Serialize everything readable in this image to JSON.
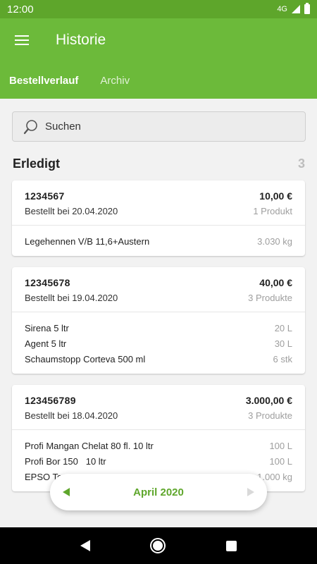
{
  "status_bar": {
    "time": "12:00",
    "network": "4G"
  },
  "app_bar": {
    "title": "Historie",
    "menu_icon": "hamburger-menu-icon"
  },
  "tabs": [
    {
      "label": "Bestellverlauf",
      "active": true
    },
    {
      "label": "Archiv",
      "active": false
    }
  ],
  "search": {
    "placeholder": "Suchen",
    "icon": "search-icon"
  },
  "section": {
    "title": "Erledigt",
    "count": "3"
  },
  "orders": [
    {
      "number": "1234567",
      "total": "10,00 €",
      "date": "Bestellt bei 20.04.2020",
      "product_count": "1 Produkt",
      "items": [
        {
          "name": "Legehennen V/B 11,6+Austern",
          "qty": "3.030 kg"
        }
      ]
    },
    {
      "number": "12345678",
      "total": "40,00 €",
      "date": "Bestellt bei 19.04.2020",
      "product_count": "3 Produkte",
      "items": [
        {
          "name": "Sirena 5 ltr",
          "qty": "20 L"
        },
        {
          "name": "Agent 5 ltr",
          "qty": "30 L"
        },
        {
          "name": "Schaumstopp Corteva 500 ml",
          "qty": "6 stk"
        }
      ]
    },
    {
      "number": "123456789",
      "total": "3.000,00 €",
      "date": "Bestellt bei 18.04.2020",
      "product_count": "3 Produkte",
      "items": [
        {
          "name": "Profi Mangan Chelat 80 fl. 10 ltr",
          "qty": "100 L"
        },
        {
          "name": "Profi Bor 150   10 ltr",
          "qty": "100 L"
        },
        {
          "name": "EPSO To",
          "qty": "1.000 kg"
        }
      ]
    }
  ],
  "month_selector": {
    "label": "April 2020"
  },
  "colors": {
    "primary": "#6cba3a",
    "status_bar": "#5ea62b",
    "accent": "#5ea62b"
  }
}
